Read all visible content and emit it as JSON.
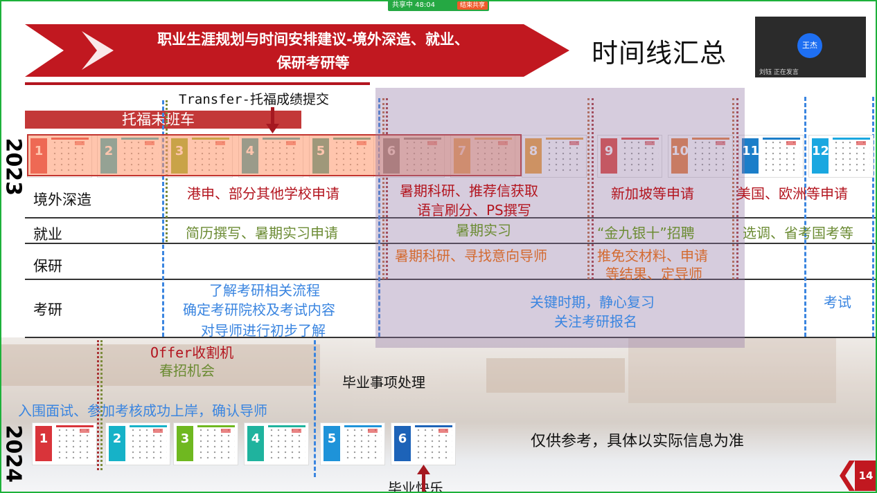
{
  "share_bar": {
    "status": "共享中 48:04",
    "stop_label": "结束共享"
  },
  "banner": {
    "title_line1": "职业生涯规划与时间安排建议-境外深造、就业、",
    "title_line2": "保研考研等"
  },
  "main_title": "时间线汇总",
  "video": {
    "avatar": "王杰",
    "speaking": "刘钰 正在发言"
  },
  "year_2023": "2023",
  "year_2024": "2024",
  "toefl_submit": "Transfer-托福成绩提交",
  "toefl_bus": "托福末班车",
  "rows": {
    "overseas": "境外深造",
    "employment": "就业",
    "baoyan": "保研",
    "kaoyan": "考研"
  },
  "overseas": {
    "hk": "港申、部分其他学校申请",
    "summer_line1": "暑期科研、推荐信获取",
    "summer_line2": "语言刷分、PS撰写",
    "sg": "新加坡等申请",
    "us": "美国、欧洲等申请"
  },
  "employment": {
    "resume": "简历撰写、暑期实习申请",
    "intern": "暑期实习",
    "jinjiu": "“金九银十”招聘",
    "exam": "选调、省考国考等"
  },
  "baoyan": {
    "summer": "暑期科研、寻找意向导师",
    "line1": "推免交材料、申请",
    "line2": "等结果、定导师"
  },
  "kaoyan": {
    "a1": "了解考研相关流程",
    "a2": "确定考研院校及考试内容",
    "a3": "对导师进行初步了解",
    "k1": "关键时期，静心复习",
    "k2": "关注考研报名",
    "test": "考试"
  },
  "y2024": {
    "offer": "Offer收割机",
    "spring": "春招机会",
    "grad": "毕业事项处理",
    "interview": "入围面试、参加考核成功上岸，确认导师",
    "happy": "毕业快乐",
    "ref": "仅供参考，具体以实际信息为准"
  },
  "months_2023": [
    "1",
    "2",
    "3",
    "4",
    "5",
    "6",
    "7",
    "8",
    "9",
    "10",
    "11",
    "12"
  ],
  "months_2024": [
    "1",
    "2",
    "3",
    "4",
    "5",
    "6"
  ],
  "page_number": "14",
  "colors": {
    "brand_red": "#c11820",
    "blue": "#3a85e0",
    "overlay": "#9278a5"
  }
}
